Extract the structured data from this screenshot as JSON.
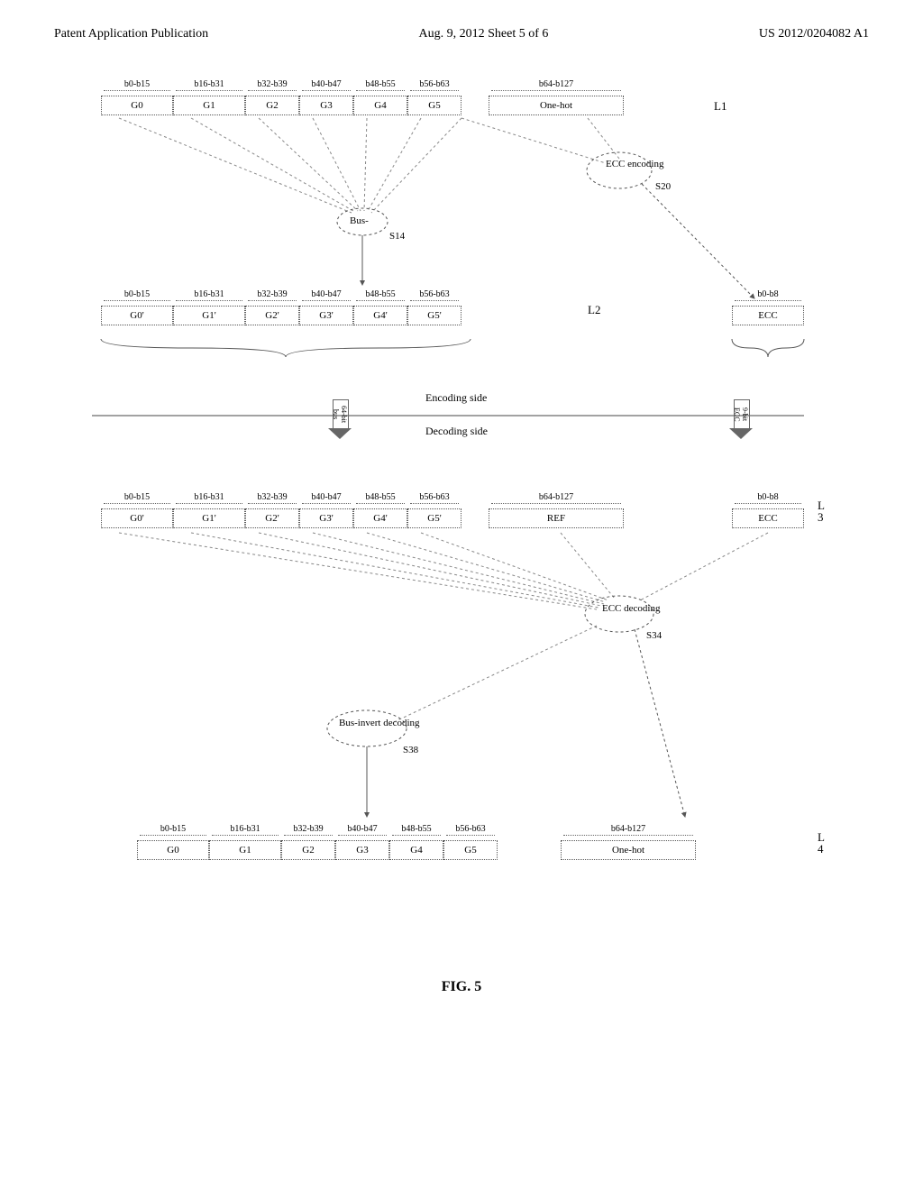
{
  "header": {
    "left": "Patent Application Publication",
    "center": "Aug. 9, 2012   Sheet 5 of 6",
    "right": "US 2012/0204082 A1"
  },
  "bit_ranges_full": [
    "b0-b15",
    "b16-b31",
    "b32-b39",
    "b40-b47",
    "b48-b55",
    "b56-b63",
    "b64-b127"
  ],
  "bit_ranges_64": [
    "b0-b15",
    "b16-b31",
    "b32-b39",
    "b40-b47",
    "b48-b55",
    "b56-b63"
  ],
  "bit_range_ecc": "b0-b8",
  "groups": [
    "G0",
    "G1",
    "G2",
    "G3",
    "G4",
    "G5"
  ],
  "groups_p": [
    "G0'",
    "G1'",
    "G2'",
    "G3'",
    "G4'",
    "G5'"
  ],
  "onehot": "One-hot",
  "ref": "REF",
  "ecc": "ECC",
  "levels": {
    "l1": "L1",
    "l2": "L2",
    "l3": "L3",
    "l4": "L4"
  },
  "level3_lines": [
    "L",
    "3"
  ],
  "level4_lines": [
    "L",
    "4"
  ],
  "proc": {
    "bus": "Bus-",
    "bus_full": "Bus-invert decoding",
    "ecc_enc": "ECC encoding",
    "ecc_dec": "ECC decoding",
    "s14": "S14",
    "s20": "S20",
    "s34": "S34",
    "s38": "S38"
  },
  "sides": {
    "enc": "Encoding side",
    "dec": "Decoding side"
  },
  "arrows": {
    "bus": "64-bit bus",
    "ecc": "9-bit ECC"
  },
  "figure_caption": "FIG. 5"
}
